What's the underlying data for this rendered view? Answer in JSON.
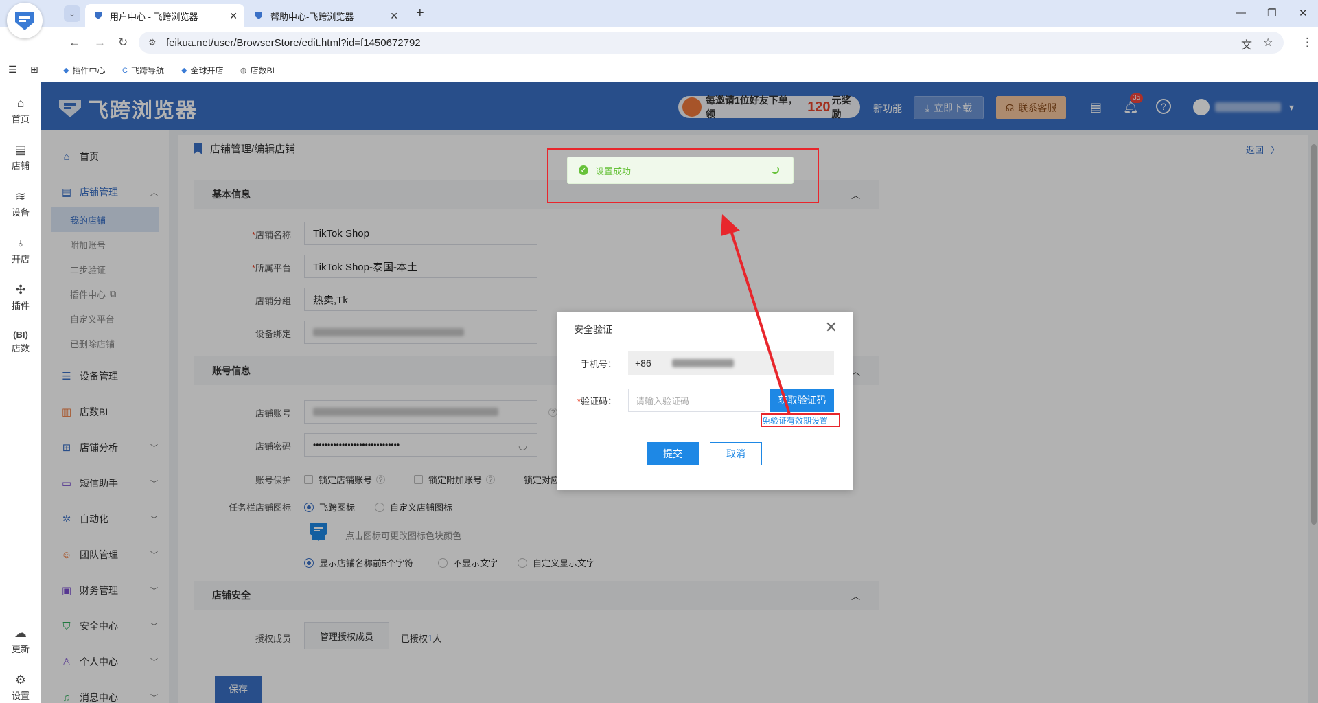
{
  "browser": {
    "tabs": [
      {
        "title": "用户中心 - 飞跨浏览器",
        "active": true
      },
      {
        "title": "帮助中心-飞跨浏览器",
        "active": false
      }
    ],
    "url": "feikua.net/user/BrowserStore/edit.html?id=f1450672792",
    "bookmarks": [
      "插件中心",
      "飞跨导航",
      "全球开店",
      "店数BI"
    ]
  },
  "header": {
    "brand": "飞跨浏览器",
    "promo_prefix": "每邀请1位好友下单，领",
    "promo_amount": "120",
    "promo_suffix": "元奖励",
    "new_feature": "新功能",
    "download": "立即下载",
    "support": "联系客服",
    "notification_count": "35"
  },
  "rail": [
    {
      "label": "首页",
      "icon": "home-icon"
    },
    {
      "label": "店铺",
      "icon": "store-icon"
    },
    {
      "label": "设备",
      "icon": "layers-icon"
    },
    {
      "label": "开店",
      "icon": "planet-icon"
    },
    {
      "label": "插件",
      "icon": "puzzle-icon"
    },
    {
      "label": "店数",
      "icon": "bi-icon"
    },
    {
      "label": "更新",
      "icon": "cloud-update-icon"
    },
    {
      "label": "设置",
      "icon": "settings-icon"
    }
  ],
  "sidebar": {
    "home": "首页",
    "store_mgmt": "店铺管理",
    "sub": [
      "我的店铺",
      "附加账号",
      "二步验证",
      "插件中心",
      "自定义平台",
      "已删除店铺"
    ],
    "items": [
      "设备管理",
      "店数BI",
      "店铺分析",
      "短信助手",
      "自动化",
      "团队管理",
      "财务管理",
      "安全中心",
      "个人中心",
      "消息中心"
    ]
  },
  "content": {
    "breadcrumb": "店铺管理/编辑店铺",
    "back": "返回",
    "section_basic": "基本信息",
    "labels": {
      "store_name": "店铺名称",
      "platform": "所属平台",
      "group": "店铺分组",
      "device": "设备绑定",
      "account": "店铺账号",
      "password": "店铺密码",
      "protect": "账号保护",
      "taskbar_icon": "任务栏店铺图标",
      "auth_members": "授权成员"
    },
    "values": {
      "store_name": "TikTok Shop",
      "platform": "TikTok Shop-泰国-本土",
      "group": "热卖,Tk",
      "password": "••••••••••••••••••••••••••••••"
    },
    "section_account": "账号信息",
    "protect_opts": [
      "锁定店铺账号",
      "锁定附加账号",
      "锁定对应"
    ],
    "icon_opts": [
      "飞跨图标",
      "自定义店铺图标"
    ],
    "icon_hint": "点击图标可更改图标色块颜色",
    "text_opts": [
      "显示店铺名称前5个字符",
      "不显示文字",
      "自定义显示文字"
    ],
    "section_security": "店铺安全",
    "manage_members": "管理授权成员",
    "authorized_prefix": "已授权",
    "authorized_count": "1",
    "authorized_suffix": "人",
    "save": "保存"
  },
  "dialog": {
    "title": "安全验证",
    "phone_label": "手机号：",
    "phone_prefix": "+86",
    "code_label": "验证码：",
    "code_placeholder": "请输入验证码",
    "get_code": "获取验证码",
    "free_link": "免验证有效期设置",
    "submit": "提交",
    "cancel": "取消"
  },
  "toast": {
    "message": "设置成功"
  },
  "colors": {
    "primary": "#3a70c6",
    "annotation": "#e8262c",
    "success": "#67c23a"
  }
}
